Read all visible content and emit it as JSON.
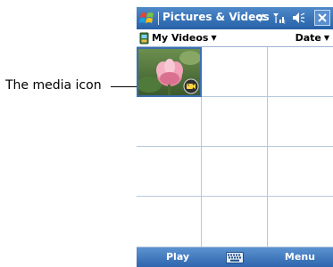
{
  "annotation": {
    "label": "The media icon"
  },
  "titlebar": {
    "title": "Pictures & Videos",
    "icons": [
      "windows-start-icon",
      "connectivity-icon",
      "signal-icon",
      "volume-icon",
      "close-icon"
    ]
  },
  "filterbar": {
    "folder_label": "My Videos",
    "sort_label": "Date"
  },
  "grid": {
    "rows": 4,
    "columns": 3,
    "items": [
      {
        "type": "video",
        "thumbnail": "pink-flower",
        "selected": true
      }
    ]
  },
  "softbar": {
    "left_label": "Play",
    "right_label": "Menu",
    "center_icon": "keyboard-icon"
  },
  "colors": {
    "title_bar": "#2761a8",
    "soft_bar": "#2e65ad",
    "selection": "#3b6fb0",
    "grid_line": "#b6c8dd"
  }
}
